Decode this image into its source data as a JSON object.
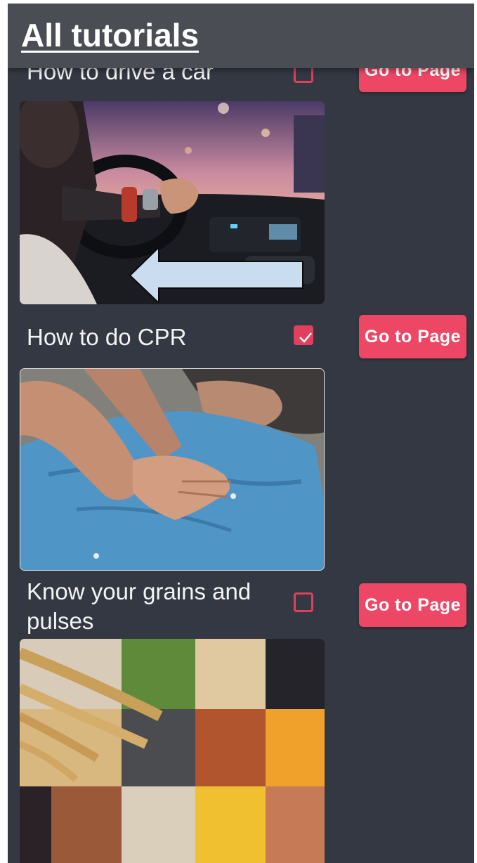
{
  "app_bar": {
    "title": "All tutorials"
  },
  "tutorials": [
    {
      "title": "How to drive a car",
      "checked": false,
      "button_label": "Go to Page",
      "image": "driving-car-photo"
    },
    {
      "title": "How to do CPR",
      "checked": true,
      "button_label": "Go to Page",
      "image": "cpr-photo"
    },
    {
      "title": "Know your grains and pulses",
      "checked": false,
      "button_label": "Go to Page",
      "image": "grains-pulses-photo"
    }
  ],
  "colors": {
    "background": "#343843",
    "app_bar": "#4a4d53",
    "accent": "#ee4766",
    "checkbox": "#e0405e",
    "text": "#f3f3f3"
  },
  "overlay": {
    "icon": "left-arrow-icon"
  }
}
